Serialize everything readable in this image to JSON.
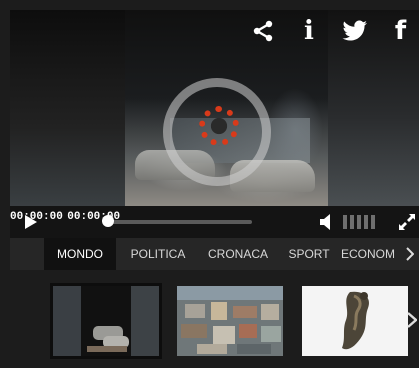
{
  "player": {
    "current_time": "00:00:00",
    "duration": "00:00:00",
    "progress": 0,
    "volume_level": 0
  },
  "share": {
    "icons": [
      "share-icon",
      "info-icon",
      "twitter-icon",
      "facebook-icon"
    ],
    "twitter_glyph": "🐦",
    "info_glyph": "i",
    "facebook_glyph": "f"
  },
  "categories": {
    "tabs": [
      "MONDO",
      "POLITICA",
      "CRONACA",
      "SPORT",
      "ECONOM"
    ],
    "active": 0
  },
  "colors": {
    "loader_accent": "#d93a1a",
    "controls_bg": "#141414",
    "tab_bar_bg": "#262626"
  }
}
